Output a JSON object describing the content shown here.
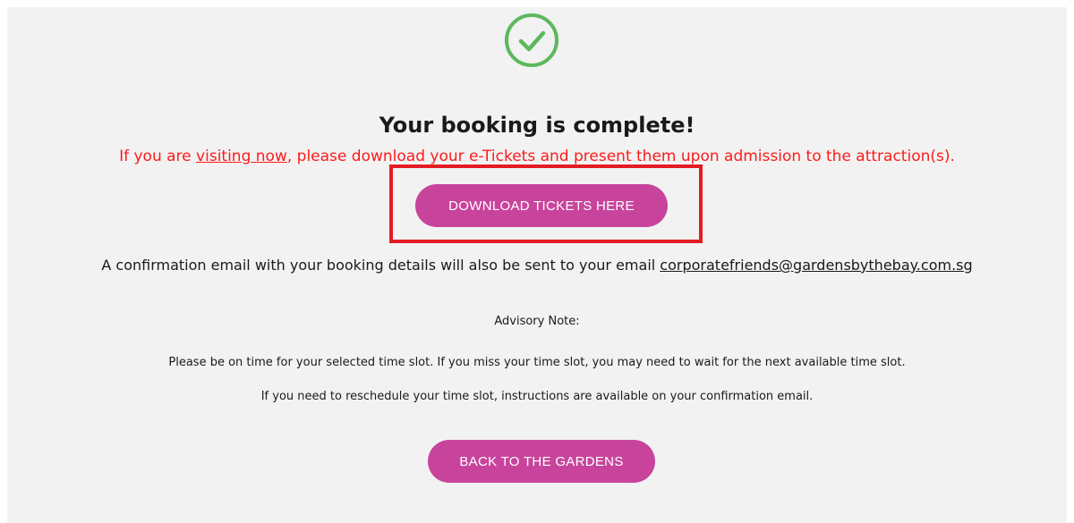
{
  "confirmation": {
    "title": "Your booking is complete!",
    "notice_prefix": "If you are ",
    "notice_link": "visiting now",
    "notice_suffix": ", please download your e-Tickets and present them upon admission to the attraction(s).",
    "download_label": "DOWNLOAD TICKETS HERE",
    "email_text": "A confirmation email with your booking details will also be sent to your email ",
    "email_address": "corporatefriends@gardensbythebay.com.sg",
    "advisory_title": "Advisory Note:",
    "advisory_line1": "Please be on time for your selected time slot. If you miss your time slot, you may need to wait for the next available time slot.",
    "advisory_line2": "If you need to reschedule your time slot, instructions are available on your confirmation email.",
    "back_label": "BACK TO THE GARDENS"
  },
  "colors": {
    "accent": "#c8449c",
    "notice": "#ff1a1a",
    "success": "#5cb85c",
    "highlight": "#e41b23",
    "panel": "#f2f2f2"
  },
  "icons": {
    "success": "check-circle-icon"
  }
}
